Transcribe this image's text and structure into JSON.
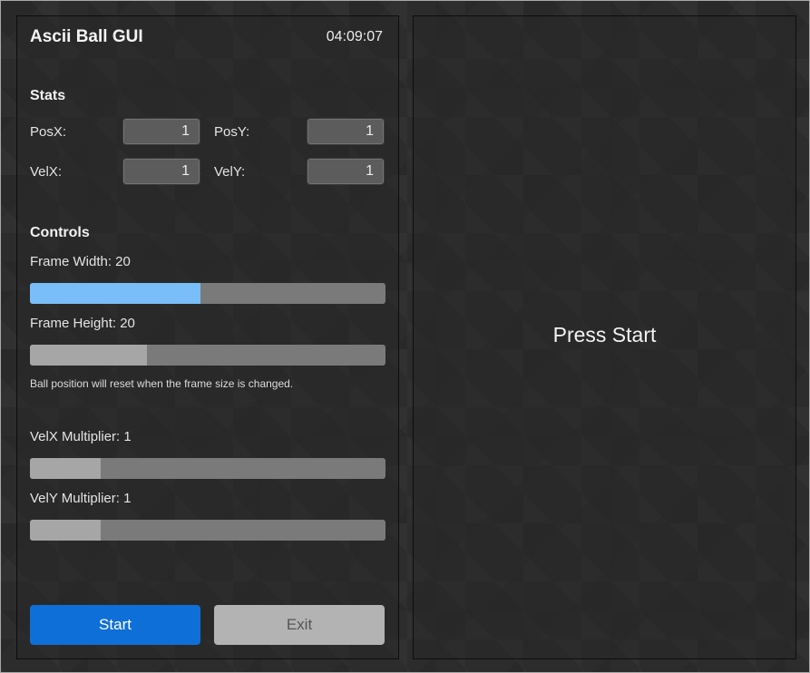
{
  "app": {
    "title": "Ascii Ball GUI",
    "clock": "04:09:07"
  },
  "stats": {
    "heading": "Stats",
    "posx": {
      "label": "PosX:",
      "value": "1"
    },
    "posy": {
      "label": "PosY:",
      "value": "1"
    },
    "velx": {
      "label": "VelX:",
      "value": "1"
    },
    "vely": {
      "label": "VelY:",
      "value": "1"
    }
  },
  "controls": {
    "heading": "Controls",
    "frame_width": {
      "label": "Frame Width: 20",
      "fill": 0.48,
      "color": "#79bef8"
    },
    "frame_height": {
      "label": "Frame Height: 20",
      "fill": 0.33,
      "color": "#a6a6a6"
    },
    "note": "Ball position will reset when the frame size is changed.",
    "velx_mult": {
      "label": "VelX Multiplier: 1",
      "fill": 0.2,
      "color": "#a6a6a6"
    },
    "vely_mult": {
      "label": "VelY Multiplier: 1",
      "fill": 0.2,
      "color": "#a6a6a6"
    }
  },
  "buttons": {
    "start": {
      "label": "Start",
      "color": "#0f6fd8",
      "text_color": "#ffffff"
    },
    "exit": {
      "label": "Exit",
      "color": "#b3b3b3",
      "text_color": "#555555"
    }
  },
  "display": {
    "message": "Press Start"
  }
}
